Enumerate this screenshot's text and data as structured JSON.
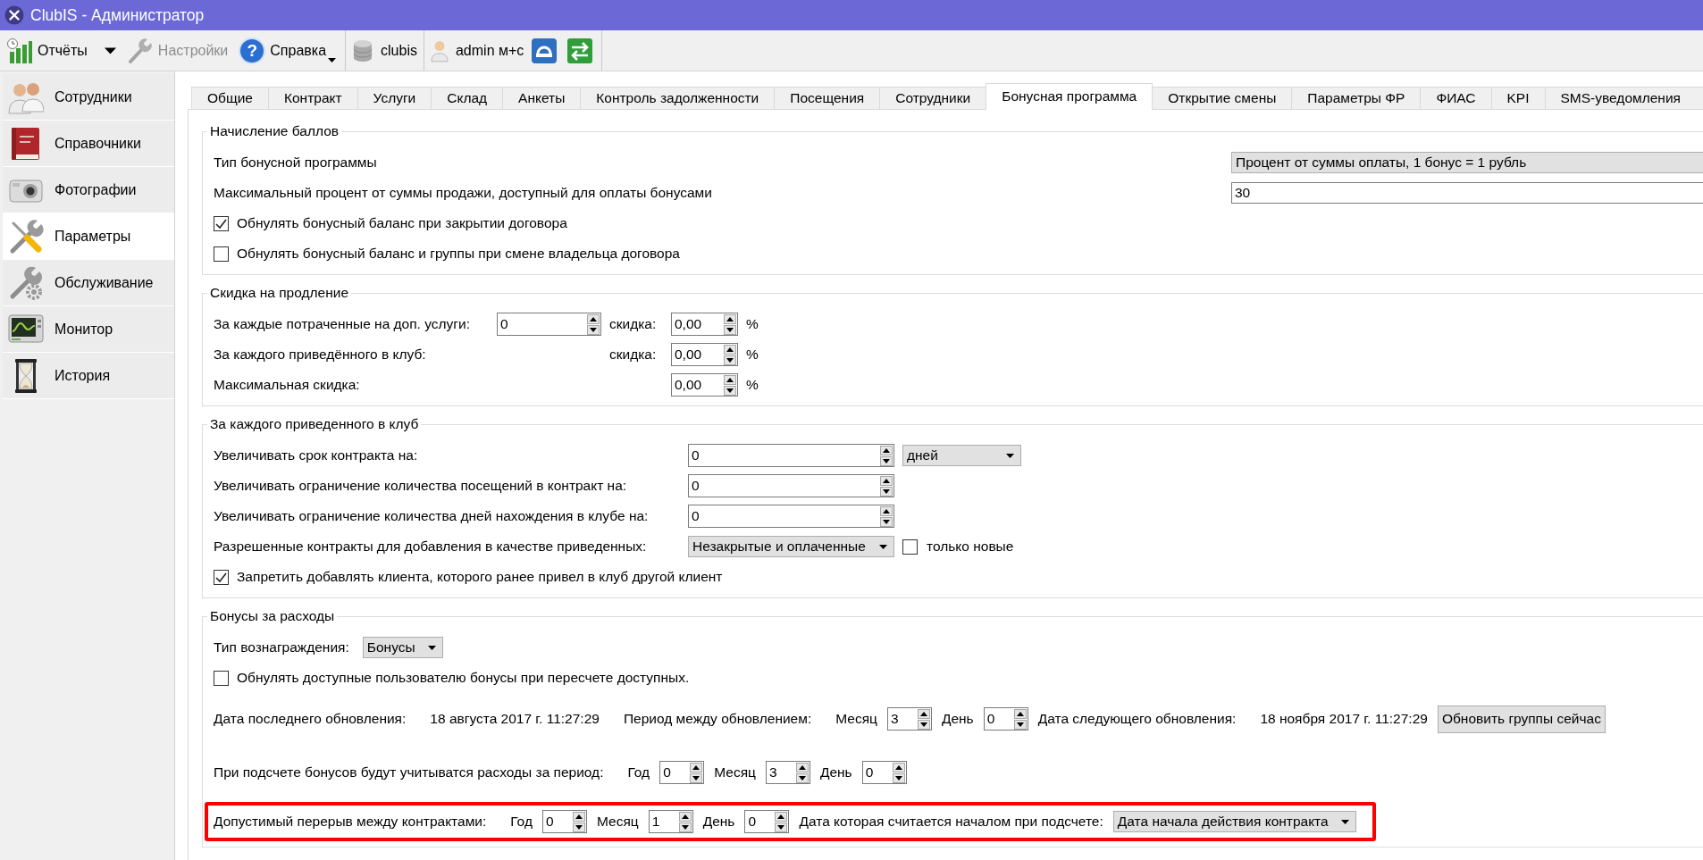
{
  "window": {
    "title": "ClubIS - Администратор"
  },
  "toolbar": {
    "groups": [
      [
        {
          "kind": "split",
          "label": "Отчёты",
          "disabled": false
        },
        {
          "kind": "button",
          "label": "Настройки",
          "disabled": true
        },
        {
          "kind": "menu",
          "label": "Справка",
          "glyph": "?",
          "disabled": false
        }
      ],
      [
        {
          "kind": "label",
          "label": "clubis",
          "disabled": false
        }
      ],
      [
        {
          "kind": "label",
          "label": "admin м+с",
          "disabled": false
        },
        {
          "kind": "icon",
          "disabled": false
        },
        {
          "kind": "icon",
          "disabled": false
        }
      ]
    ]
  },
  "sidebar": {
    "items": [
      {
        "label": "Сотрудники",
        "selected": false
      },
      {
        "label": "Справочники",
        "selected": false
      },
      {
        "label": "Фотографии",
        "selected": false
      },
      {
        "label": "Параметры",
        "selected": true
      },
      {
        "label": "Обслуживание",
        "selected": false
      },
      {
        "label": "Монитор",
        "selected": false
      },
      {
        "label": "История",
        "selected": false
      }
    ]
  },
  "tabs": [
    {
      "label": "Общие",
      "selected": false
    },
    {
      "label": "Контракт",
      "selected": false
    },
    {
      "label": "Услуги",
      "selected": false
    },
    {
      "label": "Склад",
      "selected": false
    },
    {
      "label": "Анкеты",
      "selected": false
    },
    {
      "label": "Контроль задолженности",
      "selected": false
    },
    {
      "label": "Посещения",
      "selected": false
    },
    {
      "label": "Сотрудники",
      "selected": false
    },
    {
      "label": "Бонусная программа",
      "selected": true
    },
    {
      "label": "Открытие смены",
      "selected": false
    },
    {
      "label": "Параметры ФР",
      "selected": false
    },
    {
      "label": "ФИАС",
      "selected": false
    },
    {
      "label": "KPI",
      "selected": false
    },
    {
      "label": "SMS-уведомления",
      "selected": false
    }
  ],
  "sections": [
    {
      "title": "Начисление баллов",
      "rows": [
        {
          "kind": "combo-line",
          "label": "Тип бонусной программы",
          "value": "Процент от суммы оплаты, 1 бонус = 1 рубль"
        },
        {
          "kind": "input-line",
          "label": "Максимальный процент от суммы продажи, доступный для оплаты бонусами",
          "value": "30"
        },
        {
          "kind": "check",
          "label": "Обнулять бонусный баланс при закрытии договора",
          "checked": true
        },
        {
          "kind": "check",
          "label": "Обнулять бонусный баланс и группы при смене владельца договора",
          "checked": false
        }
      ]
    },
    {
      "title": "Скидка на продление",
      "rows": [
        {
          "kind": "discount",
          "label": "За каждые потраченные на доп. услуги:",
          "amount": "0",
          "discount_label": "скидка:",
          "discount": "0,00",
          "unit": "%"
        },
        {
          "kind": "discount",
          "label": "За каждого приведённого в клуб:",
          "discount_label": "скидка:",
          "discount": "0,00",
          "unit": "%"
        },
        {
          "kind": "discount",
          "label": "Максимальная скидка:",
          "discount": "0,00",
          "unit": "%"
        }
      ]
    },
    {
      "title": "За каждого приведенного в клуб",
      "rows": [
        {
          "kind": "spin-line",
          "label": "Увеличивать срок контракта на:",
          "value": "0",
          "unit": "дней"
        },
        {
          "kind": "spin-line",
          "label": "Увеличивать ограничение количества посещений в контракт на:",
          "value": "0"
        },
        {
          "kind": "spin-line",
          "label": "Увеличивать ограничение количества дней нахождения в клубе на:",
          "value": "0"
        },
        {
          "kind": "combo-check",
          "label": "Разрешенные контракты для добавления в качестве приведенных:",
          "value": "Незакрытые и оплаченные",
          "check_label": "только новые",
          "checked": false
        },
        {
          "kind": "check",
          "label": "Запретить добавлять клиента, которого ранее привел в клуб другой клиент",
          "checked": true
        }
      ]
    },
    {
      "title": "Бонусы за расходы",
      "rows": [
        {
          "kind": "combo-inline",
          "label": "Тип вознаграждения:",
          "value": "Бонусы"
        },
        {
          "kind": "check",
          "label": "Обнулять доступные пользователю бонусы при пересчете доступных.",
          "checked": false
        },
        {
          "kind": "inline",
          "highlighted": false,
          "items": [
            {
              "kind": "text",
              "text": "Дата последнего обновления:"
            },
            {
              "kind": "text",
              "text": "18 августа 2017 г. 11:27:29"
            },
            {
              "kind": "text",
              "text": "Период между обновлением:"
            },
            {
              "kind": "text",
              "text": "Месяц"
            },
            {
              "kind": "spin",
              "value": "3"
            },
            {
              "kind": "text",
              "text": "День"
            },
            {
              "kind": "spin",
              "value": "0"
            },
            {
              "kind": "text",
              "text": "Дата следующего обновления:"
            },
            {
              "kind": "text",
              "text": "18 ноября 2017 г. 11:27:29"
            },
            {
              "kind": "button",
              "label": "Обновить группы сейчас"
            }
          ]
        },
        {
          "kind": "inline",
          "highlighted": false,
          "items": [
            {
              "kind": "text",
              "text": "При подсчете бонусов будут учитыватся расходы за период:"
            },
            {
              "kind": "text",
              "text": "Год"
            },
            {
              "kind": "spin",
              "value": "0"
            },
            {
              "kind": "text",
              "text": "Месяц"
            },
            {
              "kind": "spin",
              "value": "3"
            },
            {
              "kind": "text",
              "text": "День"
            },
            {
              "kind": "spin",
              "value": "0"
            }
          ]
        },
        {
          "kind": "inline",
          "highlighted": true,
          "items": [
            {
              "kind": "text",
              "text": "Допустимый перерыв между контрактами:"
            },
            {
              "kind": "text",
              "text": "Год"
            },
            {
              "kind": "spin",
              "value": "0"
            },
            {
              "kind": "text",
              "text": "Месяц"
            },
            {
              "kind": "spin",
              "value": "1"
            },
            {
              "kind": "text",
              "text": "День"
            },
            {
              "kind": "spin",
              "value": "0"
            },
            {
              "kind": "text",
              "text": "Дата которая считается началом при подсчете:"
            },
            {
              "kind": "combo",
              "value": "Дата начала действия контракта"
            }
          ]
        }
      ]
    }
  ]
}
